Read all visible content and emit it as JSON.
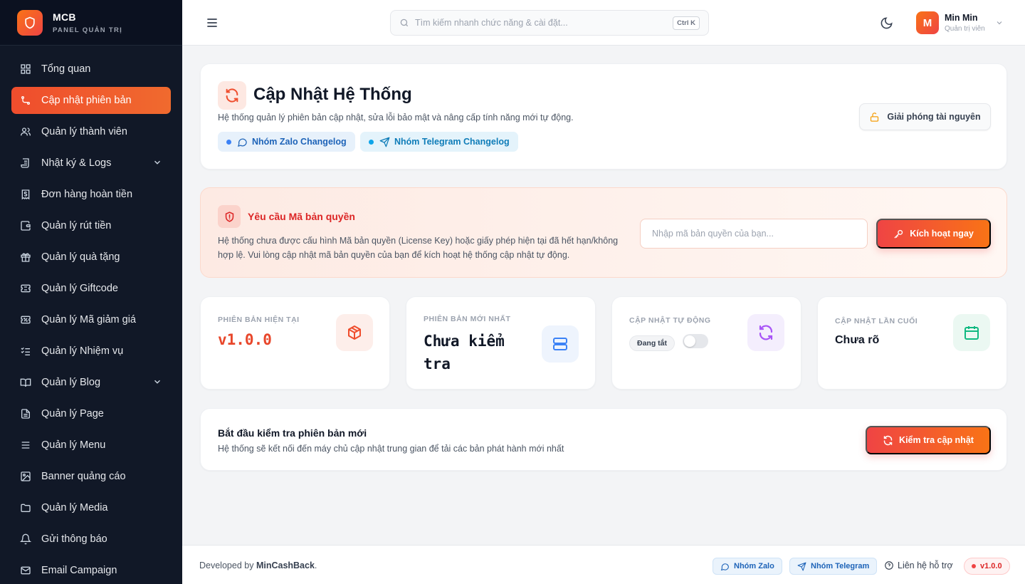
{
  "brand": {
    "name": "MCB",
    "subtitle": "PANEL QUẢN TRỊ"
  },
  "sidebar": {
    "items": [
      {
        "label": "Tổng quan",
        "icon": "dashboard-icon"
      },
      {
        "label": "Cập nhật phiên bản",
        "icon": "git-update-icon",
        "active": true
      },
      {
        "label": "Quản lý thành viên",
        "icon": "users-icon"
      },
      {
        "label": "Nhật ký & Logs",
        "icon": "scroll-icon",
        "expandable": true
      },
      {
        "label": "Đơn hàng hoàn tiền",
        "icon": "receipt-dollar-icon"
      },
      {
        "label": "Quản lý rút tiền",
        "icon": "wallet-icon"
      },
      {
        "label": "Quản lý quà tặng",
        "icon": "gift-icon"
      },
      {
        "label": "Quản lý Giftcode",
        "icon": "ticket-icon"
      },
      {
        "label": "Quản lý Mã giảm giá",
        "icon": "coupon-icon"
      },
      {
        "label": "Quản lý Nhiệm vụ",
        "icon": "tasks-icon"
      },
      {
        "label": "Quản lý Blog",
        "icon": "book-icon",
        "expandable": true
      },
      {
        "label": "Quản lý Page",
        "icon": "file-icon"
      },
      {
        "label": "Quản lý Menu",
        "icon": "menu-icon"
      },
      {
        "label": "Banner quảng cáo",
        "icon": "image-icon"
      },
      {
        "label": "Quản lý Media",
        "icon": "folder-icon"
      },
      {
        "label": "Gửi thông báo",
        "icon": "bell-icon"
      },
      {
        "label": "Email Campaign",
        "icon": "mail-icon"
      }
    ]
  },
  "topbar": {
    "search_placeholder": "Tìm kiếm nhanh chức năng & cài đặt...",
    "search_shortcut": "Ctrl K",
    "user": {
      "initial": "M",
      "name": "Min Min",
      "role": "Quản trị viên"
    }
  },
  "hero": {
    "title": "Cập Nhật Hệ Thống",
    "description": "Hệ thống quản lý phiên bản cập nhật, sửa lỗi bảo mật và nâng cấp tính năng mới tự động.",
    "zalo_chip": "Nhóm Zalo Changelog",
    "telegram_chip": "Nhóm Telegram Changelog",
    "release_button": "Giải phóng tài nguyên"
  },
  "license": {
    "title": "Yêu cầu Mã bản quyền",
    "description": "Hệ thống chưa được cấu hình Mã bản quyền (License Key) hoặc giấy phép hiện tại đã hết hạn/không hợp lệ. Vui lòng cập nhật mã bản quyền của bạn để kích hoạt hệ thống cập nhật tự động.",
    "input_placeholder": "Nhập mã bản quyền của bạn...",
    "activate_button": "Kích hoạt ngay"
  },
  "stats": {
    "current": {
      "label": "PHIÊN BẢN HIỆN TẠI",
      "value": "v1.0.0"
    },
    "latest": {
      "label": "PHIÊN BẢN MỚI NHẤT",
      "value": "Chưa kiểm tra"
    },
    "auto": {
      "label": "CẬP NHẬT TỰ ĐỘNG",
      "status": "Đang tắt",
      "enabled": false
    },
    "last": {
      "label": "CẬP NHẬT LẦN CUỐI",
      "value": "Chưa rõ"
    }
  },
  "check": {
    "title": "Bắt đầu kiểm tra phiên bản mới",
    "description": "Hệ thống sẽ kết nối đến máy chủ cập nhật trung gian để tải các bản phát hành mới nhất",
    "button": "Kiểm tra cập nhật"
  },
  "footer": {
    "developed_prefix": "Developed by",
    "developer": "MinCashBack",
    "zalo": "Nhóm Zalo",
    "telegram": "Nhóm Telegram",
    "support": "Liên hệ hỗ trợ",
    "version": "v1.0.0"
  },
  "colors": {
    "accent": "#ef4d2d",
    "sidebar_bg": "#111827",
    "info": "#1d63b8",
    "danger": "#dc2626"
  }
}
